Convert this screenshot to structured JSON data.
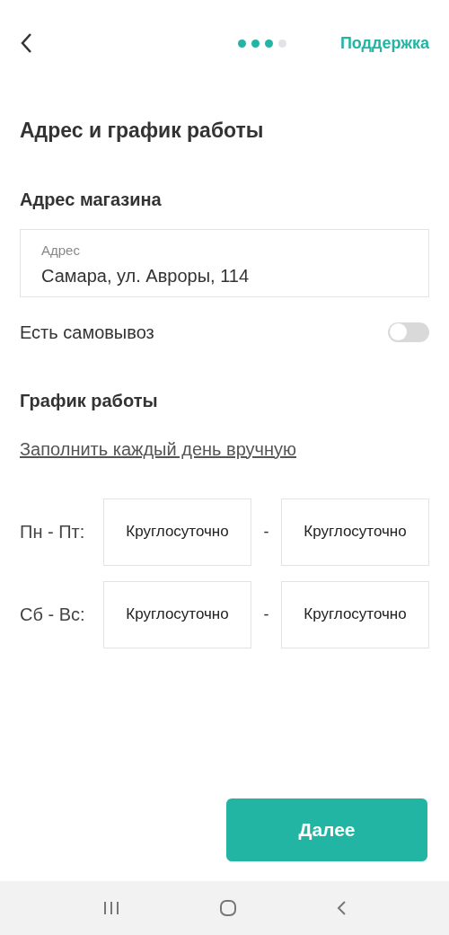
{
  "header": {
    "progress": [
      {
        "done": true
      },
      {
        "done": true
      },
      {
        "done": true
      },
      {
        "done": false
      }
    ],
    "support_link": "Поддержка"
  },
  "title": "Адрес и график работы",
  "address_section": {
    "heading": "Адрес магазина",
    "field": {
      "label": "Адрес",
      "value": "Самара, ул. Авроры, 114"
    },
    "pickup": {
      "label": "Есть самовывоз",
      "on": false
    }
  },
  "schedule_section": {
    "heading": "График работы",
    "manual_link": "Заполнить каждый день вручную",
    "rows": [
      {
        "days": "Пн - Пт:",
        "from": "Круглосуточно",
        "separator": "-",
        "to": "Круглосуточно"
      },
      {
        "days": "Сб - Вс:",
        "from": "Круглосуточно",
        "separator": "-",
        "to": "Круглосуточно"
      }
    ]
  },
  "next_button": "Далее"
}
